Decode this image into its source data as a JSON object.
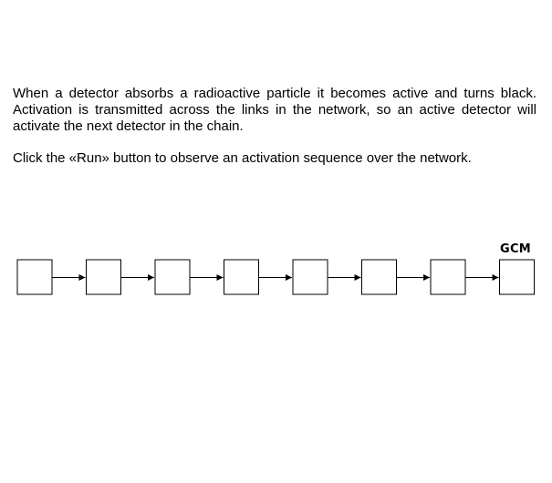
{
  "instructions": {
    "paragraph1": "When a detector absorbs a radioactive particle it becomes active and turns black. Activation is transmitted across the links in the network, so an active detector will activate the next detector in the chain.",
    "paragraph2": "Click the «Run» button to observe an activation sequence over the network."
  },
  "network": {
    "detector_count": 8,
    "end_label": "GCM",
    "detector_states": [
      "inactive",
      "inactive",
      "inactive",
      "inactive",
      "inactive",
      "inactive",
      "inactive",
      "inactive"
    ],
    "colors": {
      "inactive_fill": "#ffffff",
      "active_fill": "#000000",
      "stroke": "#000000"
    }
  }
}
